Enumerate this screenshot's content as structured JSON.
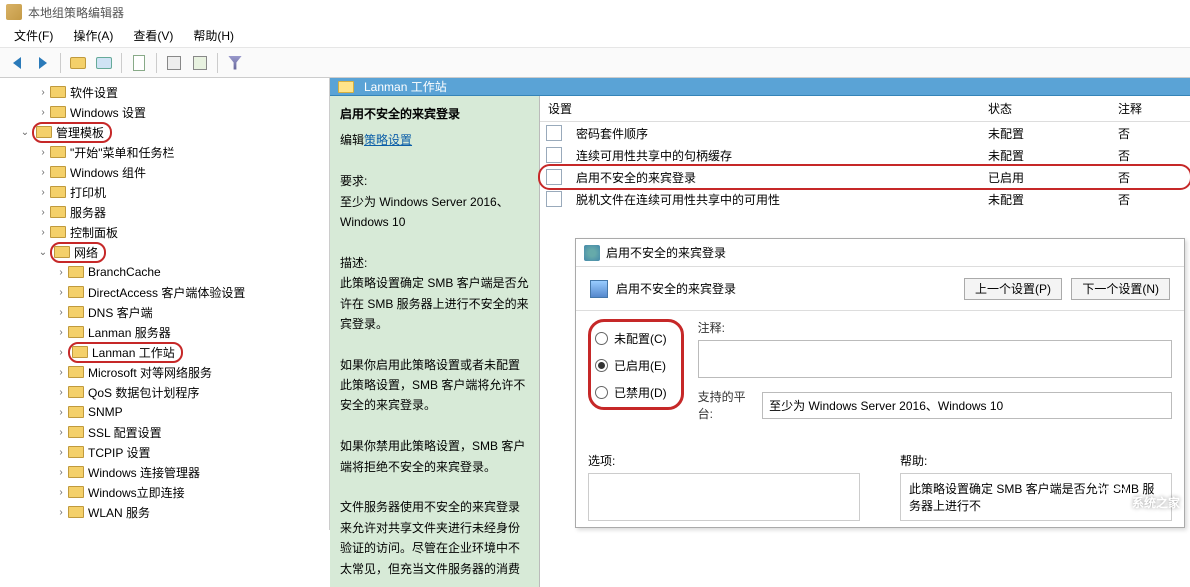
{
  "window": {
    "title": "本地组策略编辑器"
  },
  "menubar": {
    "items": [
      "文件(F)",
      "操作(A)",
      "查看(V)",
      "帮助(H)"
    ]
  },
  "tree": {
    "items": [
      {
        "label": "软件设置",
        "indent": 2
      },
      {
        "label": "Windows 设置",
        "indent": 2
      },
      {
        "label": "管理模板",
        "indent": 1,
        "expanded": true,
        "hl": true
      },
      {
        "label": "\"开始\"菜单和任务栏",
        "indent": 2
      },
      {
        "label": "Windows 组件",
        "indent": 2
      },
      {
        "label": "打印机",
        "indent": 2
      },
      {
        "label": "服务器",
        "indent": 2
      },
      {
        "label": "控制面板",
        "indent": 2
      },
      {
        "label": "网络",
        "indent": 2,
        "expanded": true,
        "hl": true
      },
      {
        "label": "BranchCache",
        "indent": 3
      },
      {
        "label": "DirectAccess 客户端体验设置",
        "indent": 3
      },
      {
        "label": "DNS 客户端",
        "indent": 3
      },
      {
        "label": "Lanman 服务器",
        "indent": 3
      },
      {
        "label": "Lanman 工作站",
        "indent": 3,
        "hl": true
      },
      {
        "label": "Microsoft 对等网络服务",
        "indent": 3
      },
      {
        "label": "QoS 数据包计划程序",
        "indent": 3
      },
      {
        "label": "SNMP",
        "indent": 3
      },
      {
        "label": "SSL 配置设置",
        "indent": 3
      },
      {
        "label": "TCPIP 设置",
        "indent": 3
      },
      {
        "label": "Windows 连接管理器",
        "indent": 3
      },
      {
        "label": "Windows立即连接",
        "indent": 3
      },
      {
        "label": "WLAN 服务",
        "indent": 3
      }
    ]
  },
  "content": {
    "header": "Lanman 工作站",
    "desc": {
      "title": "启用不安全的来宾登录",
      "edit_prefix": "编辑",
      "edit_link": "策略设置",
      "req_label": "要求:",
      "req_text": "至少为 Windows Server 2016、Windows 10",
      "desc_label": "描述:",
      "desc1": "此策略设置确定 SMB 客户端是否允许在 SMB 服务器上进行不安全的来宾登录。",
      "desc2": "如果你启用此策略设置或者未配置此策略设置，SMB 客户端将允许不安全的来宾登录。",
      "desc3": "如果你禁用此策略设置，SMB 客户端将拒绝不安全的来宾登录。",
      "desc4": "文件服务器使用不安全的来宾登录来允许对共享文件夹进行未经身份验证的访问。尽管在企业环境中不太常见，但充当文件服务器的消费"
    },
    "columns": {
      "setting": "设置",
      "state": "状态",
      "note": "注释"
    },
    "rows": [
      {
        "setting": "密码套件顺序",
        "state": "未配置",
        "note": "否"
      },
      {
        "setting": "连续可用性共享中的句柄缓存",
        "state": "未配置",
        "note": "否"
      },
      {
        "setting": "启用不安全的来宾登录",
        "state": "已启用",
        "note": "否",
        "hl": true
      },
      {
        "setting": "脱机文件在连续可用性共享中的可用性",
        "state": "未配置",
        "note": "否"
      }
    ]
  },
  "dialog": {
    "title": "启用不安全的来宾登录",
    "subtitle": "启用不安全的来宾登录",
    "prev_btn": "上一个设置(P)",
    "next_btn": "下一个设置(N)",
    "radios": {
      "not_configured": "未配置(C)",
      "enabled": "已启用(E)",
      "disabled": "已禁用(D)"
    },
    "note_label": "注释:",
    "platform_label": "支持的平台:",
    "platform_text": "至少为 Windows Server 2016、Windows 10",
    "options_label": "选项:",
    "help_label": "帮助:",
    "help_text": "此策略设置确定 SMB 客户端是否允许 SMB 服务器上进行不"
  },
  "watermark": "系统之家"
}
